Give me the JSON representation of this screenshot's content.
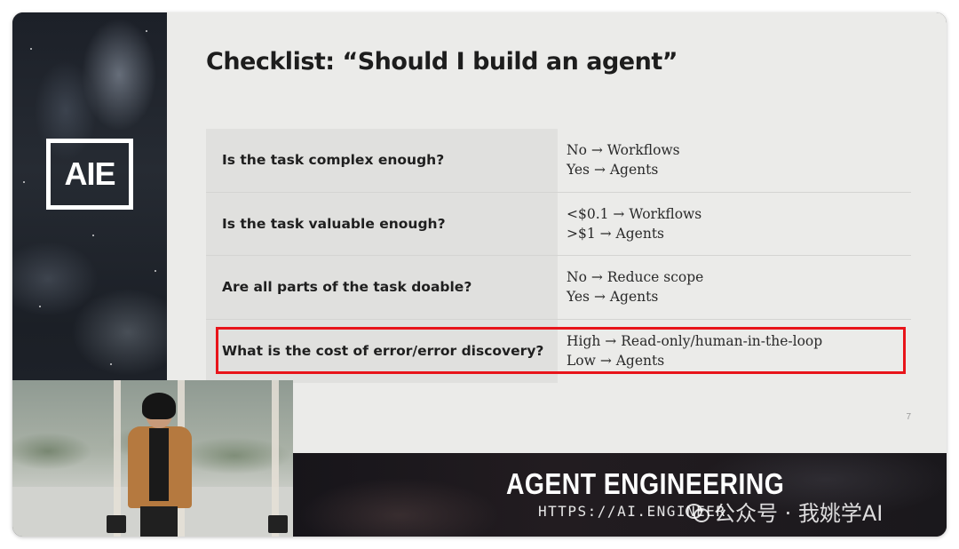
{
  "slide": {
    "title": "Checklist: “Should I build an agent”",
    "page_number": "7",
    "rows": [
      {
        "question": "Is the task complex enough?",
        "answer_line1": "No → Workflows",
        "answer_line2": "Yes → Agents",
        "highlighted": false
      },
      {
        "question": "Is the task valuable enough?",
        "answer_line1": "<$0.1 → Workflows",
        "answer_line2": ">$1  → Agents",
        "highlighted": false
      },
      {
        "question": "Are all parts of the task doable?",
        "answer_line1": "No → Reduce scope",
        "answer_line2": "Yes → Agents",
        "highlighted": false
      },
      {
        "question": "What is the cost of error/error discovery?",
        "answer_line1": "High → Read-only/human-in-the-loop",
        "answer_line2": "Low → Agents",
        "highlighted": true
      }
    ],
    "highlight_color": "#e8141a"
  },
  "logo": {
    "text": "AIE"
  },
  "banner": {
    "title": "AGENT ENGINEERING",
    "url": "HTTPS://AI.ENGINEER",
    "watermark": "公众号 · 我姚学AI"
  },
  "colors": {
    "slide_bg": "#ebebe9",
    "question_bg": "#e0e0de",
    "text": "#1f1f1f"
  }
}
